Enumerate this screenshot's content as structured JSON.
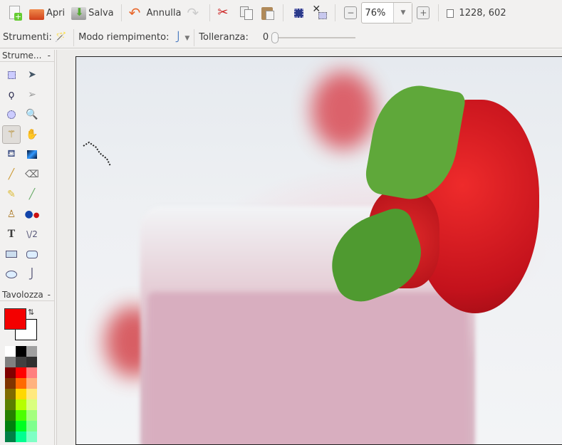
{
  "toolbar": {
    "new_label": "",
    "open_label": "Apri",
    "save_label": "Salva",
    "undo_label": "Annulla",
    "zoom_value": "76%",
    "image_size": "1228, 602"
  },
  "toolbar2": {
    "tools_label": "Strumenti:",
    "fill_mode_label": "Modo riempimento:",
    "tolerance_label": "Tolleranza:",
    "tolerance_value": "0"
  },
  "tools_panel": {
    "title": "Strume...",
    "collapse": "-"
  },
  "palette_panel": {
    "title": "Tavolozza",
    "collapse": "-",
    "primary_color": "#f40000",
    "secondary_color": "#ffffff",
    "colors": [
      "#ffffff",
      "#000000",
      "#a0a0a0",
      "#808080",
      "#404040",
      "#303030",
      "#7f0000",
      "#ff0000",
      "#ff7f7f",
      "#7f3300",
      "#ff6a00",
      "#ffb27f",
      "#7f6a00",
      "#ffd800",
      "#ffe97f",
      "#5b7f00",
      "#b6ff00",
      "#daff7f",
      "#267f00",
      "#4cff00",
      "#a5ff7f",
      "#007f0e",
      "#00ff21",
      "#7fff8e",
      "#007f46",
      "#00ff90",
      "#7fffc5"
    ]
  }
}
